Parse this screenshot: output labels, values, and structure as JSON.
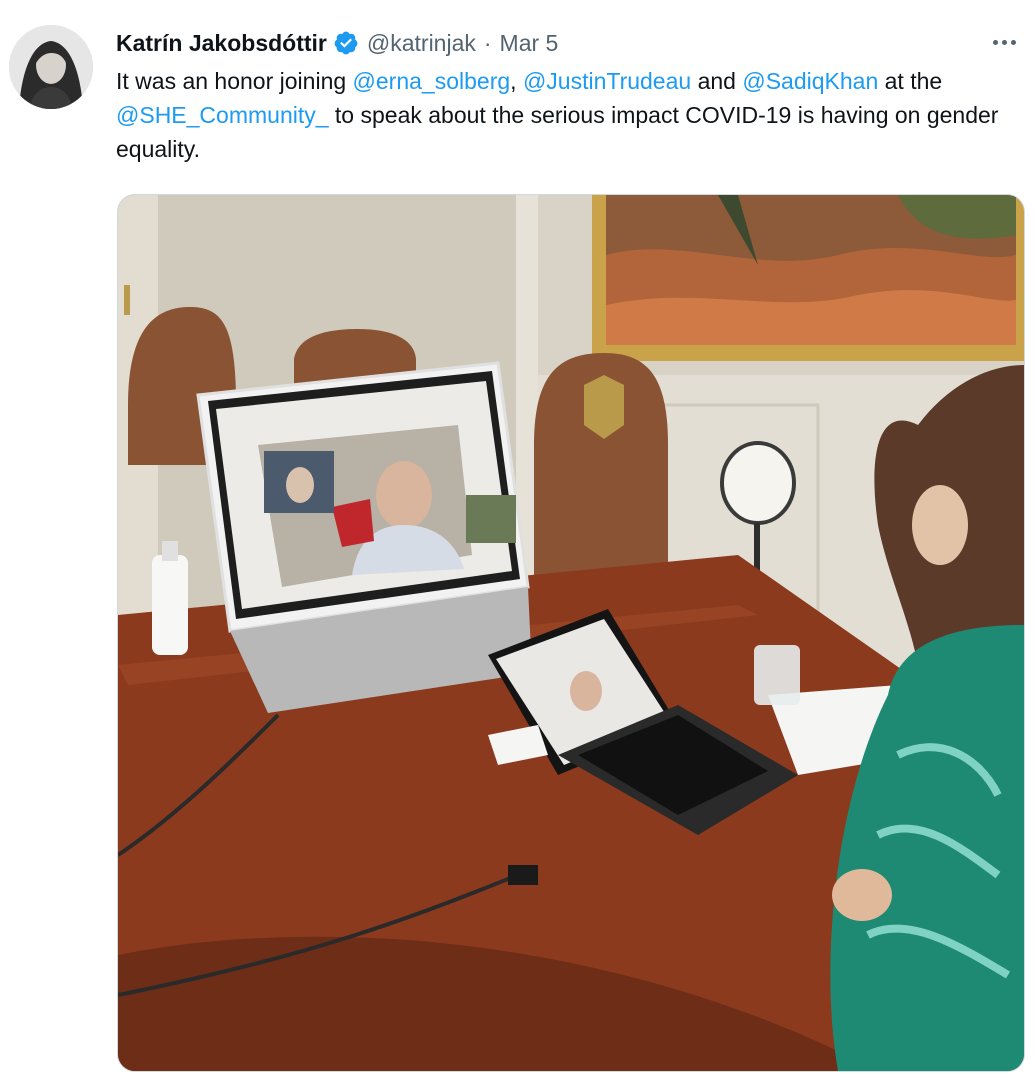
{
  "tweet": {
    "display_name": "Katrín Jakobsdóttir",
    "handle": "@katrinjak",
    "separator": "·",
    "date": "Mar 5",
    "text_parts": {
      "p1": "It was an honor joining ",
      "m1": "@erna_solberg",
      "p2": ", ",
      "m2": "@JustinTrudeau",
      "p3": " and ",
      "m3": "@SadiqKhan",
      "p4": " at the ",
      "m4": "@SHE_Community_",
      "p5": " to speak about the serious impact COVID-19 is having on gender equality."
    },
    "icons": {
      "verified": "verified-badge-icon",
      "more": "more-options-icon"
    }
  },
  "colors": {
    "link": "#1d9bf0",
    "secondary_text": "#536471",
    "verified": "#1d9bf0"
  }
}
